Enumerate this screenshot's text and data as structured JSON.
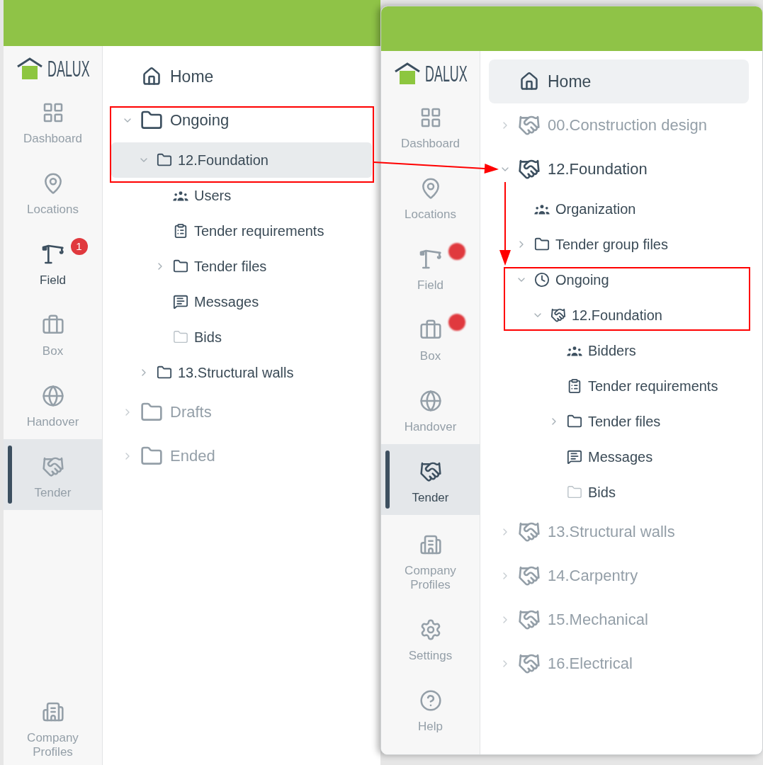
{
  "windows": [
    {
      "logo": "DALUX",
      "nav": [
        {
          "kind": "dashboard",
          "label": "Dashboard",
          "obscured": true,
          "selected": false
        },
        {
          "kind": "locations",
          "label": "Locations",
          "obscured": true,
          "selected": false
        },
        {
          "kind": "field",
          "label": "Field",
          "obscured": false,
          "selected": false,
          "badge": {
            "text": "1",
            "obscured": false
          }
        },
        {
          "kind": "box",
          "label": "Box",
          "obscured": true,
          "selected": false
        },
        {
          "kind": "handover",
          "label": "Handover",
          "obscured": true,
          "selected": false
        },
        {
          "kind": "tender",
          "label": "Tender",
          "obscured": true,
          "selected": true
        }
      ],
      "nav_bottom": [
        {
          "kind": "company",
          "label": "Company Profiles",
          "obscured": true,
          "selected": false
        }
      ],
      "home": {
        "label": "Home",
        "selected": false
      },
      "tree": [
        {
          "kind": "folder",
          "label": "Ongoing",
          "expanded": true,
          "obscured": false,
          "selected": false,
          "children": [
            {
              "kind": "folder",
              "label": "12.Foundation",
              "expanded": true,
              "obscured": false,
              "selected": true,
              "children": [
                {
                  "kind": "users",
                  "label": "Users",
                  "obscured": false,
                  "selected": false
                },
                {
                  "kind": "checklist",
                  "label": "Tender requirements",
                  "obscured": false,
                  "selected": false
                },
                {
                  "kind": "folder",
                  "label": "Tender files",
                  "expanded": false,
                  "obscured": false,
                  "selected": false
                },
                {
                  "kind": "messages",
                  "label": "Messages",
                  "obscured": false,
                  "selected": false
                },
                {
                  "kind": "empty-folder",
                  "label": "Bids",
                  "obscured": false,
                  "selected": false
                }
              ]
            },
            {
              "kind": "folder",
              "label": "13.Structural walls",
              "expanded": false,
              "obscured": false,
              "selected": false
            }
          ]
        },
        {
          "kind": "folder",
          "label": "Drafts",
          "expanded": false,
          "obscured": true,
          "selected": false
        },
        {
          "kind": "folder",
          "label": "Ended",
          "expanded": false,
          "obscured": true,
          "selected": false
        }
      ]
    },
    {
      "logo": "DALUX",
      "nav": [
        {
          "kind": "dashboard",
          "label": "Dashboard",
          "obscured": true,
          "selected": false
        },
        {
          "kind": "locations",
          "label": "Locations",
          "obscured": true,
          "selected": false
        },
        {
          "kind": "field",
          "label": "Field",
          "obscured": true,
          "selected": false,
          "badge": {
            "obscured": true
          }
        },
        {
          "kind": "box",
          "label": "Box",
          "obscured": true,
          "selected": false,
          "badge": {
            "obscured": true
          }
        },
        {
          "kind": "handover",
          "label": "Handover",
          "obscured": true,
          "selected": false
        },
        {
          "kind": "tender",
          "label": "Tender",
          "obscured": false,
          "selected": true
        }
      ],
      "nav_bottom": [
        {
          "kind": "company",
          "label": "Company Profiles",
          "obscured": true,
          "selected": false
        },
        {
          "kind": "settings",
          "label": "Settings",
          "obscured": true,
          "selected": false
        },
        {
          "kind": "help",
          "label": "Help",
          "obscured": true,
          "selected": false
        }
      ],
      "home": {
        "label": "Home",
        "selected": true
      },
      "tree": [
        {
          "kind": "handshake",
          "label": "00.Construction design",
          "expanded": false,
          "obscured": true,
          "selected": false
        },
        {
          "kind": "handshake",
          "label": "12.Foundation",
          "expanded": true,
          "obscured": false,
          "selected": false,
          "children": [
            {
              "kind": "users",
              "label": "Organization",
              "obscured": false,
              "selected": false
            },
            {
              "kind": "folder",
              "label": "Tender group files",
              "expanded": false,
              "obscured": false,
              "selected": false
            },
            {
              "kind": "clock",
              "label": "Ongoing",
              "expanded": true,
              "obscured": false,
              "selected": false,
              "children": [
                {
                  "kind": "handshake",
                  "label": "12.Foundation",
                  "expanded": true,
                  "obscured": false,
                  "selected": false,
                  "children": [
                    {
                      "kind": "users",
                      "label": "Bidders",
                      "obscured": false,
                      "selected": false
                    },
                    {
                      "kind": "checklist",
                      "label": "Tender requirements",
                      "obscured": false,
                      "selected": false
                    },
                    {
                      "kind": "folder",
                      "label": "Tender files",
                      "expanded": false,
                      "obscured": false,
                      "selected": false
                    },
                    {
                      "kind": "messages",
                      "label": "Messages",
                      "obscured": false,
                      "selected": false
                    },
                    {
                      "kind": "empty-folder",
                      "label": "Bids",
                      "obscured": false,
                      "selected": false
                    }
                  ]
                }
              ]
            }
          ]
        },
        {
          "kind": "handshake",
          "label": "13.Structural walls",
          "expanded": false,
          "obscured": true,
          "selected": false
        },
        {
          "kind": "handshake",
          "label": "14.Carpentry",
          "expanded": false,
          "obscured": true,
          "selected": false
        },
        {
          "kind": "handshake",
          "label": "15.Mechanical",
          "expanded": false,
          "obscured": true,
          "selected": false
        },
        {
          "kind": "handshake",
          "label": "16.Electrical",
          "expanded": false,
          "obscured": true,
          "selected": false
        }
      ]
    }
  ],
  "annotations": [
    {
      "kind": "frame"
    },
    {
      "kind": "right-arrow"
    },
    {
      "kind": "down-arrow"
    },
    {
      "kind": "frame"
    }
  ]
}
